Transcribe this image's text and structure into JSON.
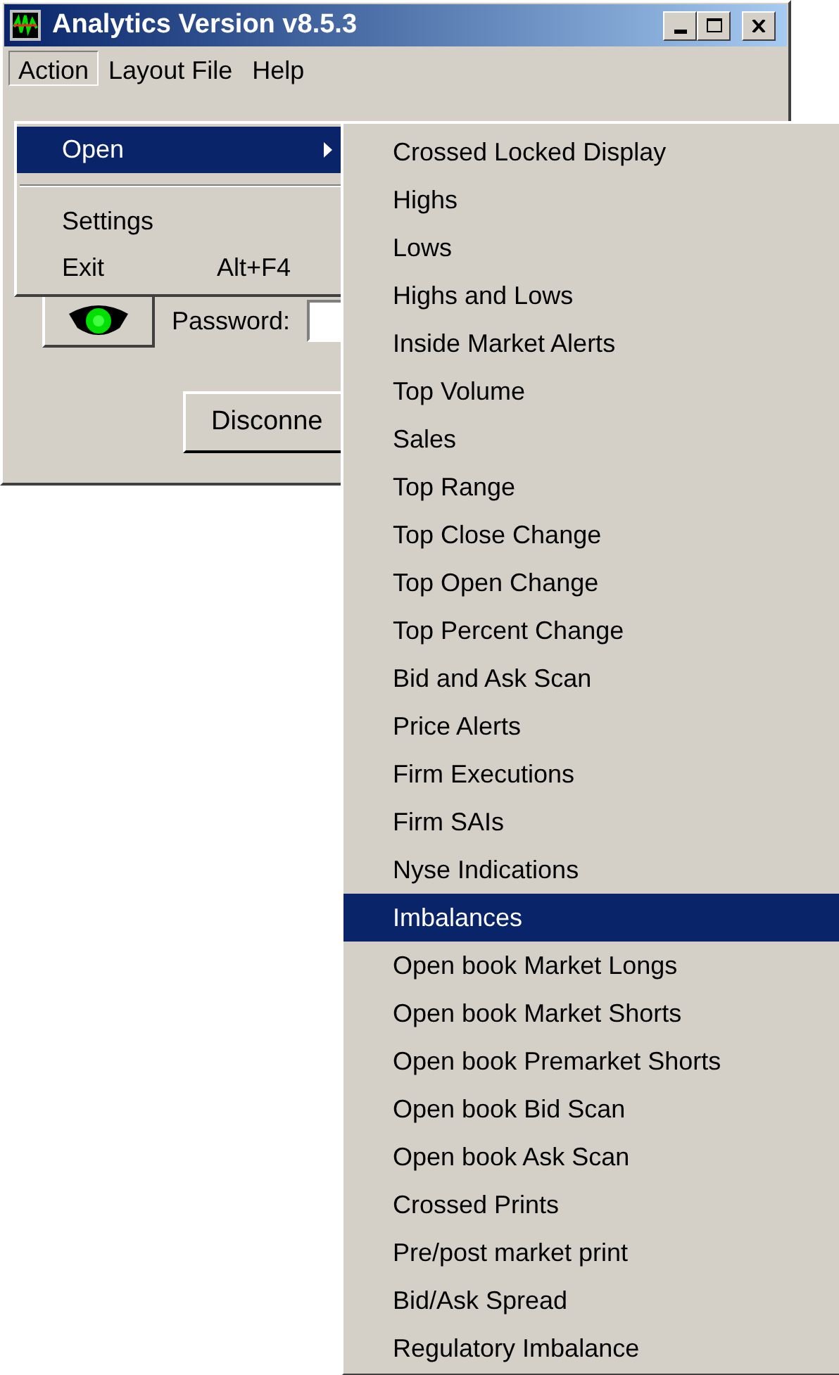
{
  "window": {
    "title": "Analytics Version v8.5.3"
  },
  "menu_bar": [
    {
      "label": "Action",
      "selected": true
    },
    {
      "label": "Layout File",
      "selected": false
    },
    {
      "label": "Help",
      "selected": false
    }
  ],
  "action_menu": [
    {
      "kind": "item",
      "label": "Open",
      "has_submenu": true,
      "selected": true
    },
    {
      "kind": "separator"
    },
    {
      "kind": "item",
      "label": "Settings",
      "selected": false
    },
    {
      "kind": "item",
      "label": "Exit",
      "shortcut": "Alt+F4",
      "selected": false
    }
  ],
  "body": {
    "password_label": "Password:",
    "disconnect_button": "Disconne"
  },
  "open_submenu": [
    {
      "label": "Crossed Locked Display",
      "selected": false
    },
    {
      "label": "Highs",
      "selected": false
    },
    {
      "label": "Lows",
      "selected": false
    },
    {
      "label": "Highs and Lows",
      "selected": false
    },
    {
      "label": "Inside Market Alerts",
      "selected": false
    },
    {
      "label": "Top Volume",
      "selected": false
    },
    {
      "label": "Sales",
      "selected": false
    },
    {
      "label": "Top Range",
      "selected": false
    },
    {
      "label": "Top Close Change",
      "selected": false
    },
    {
      "label": "Top Open Change",
      "selected": false
    },
    {
      "label": "Top Percent Change",
      "selected": false
    },
    {
      "label": "Bid and Ask Scan",
      "selected": false
    },
    {
      "label": "Price Alerts",
      "selected": false
    },
    {
      "label": "Firm Executions",
      "selected": false
    },
    {
      "label": "Firm SAIs",
      "selected": false
    },
    {
      "label": "Nyse Indications",
      "selected": false
    },
    {
      "label": "Imbalances",
      "selected": true
    },
    {
      "label": "Open book Market Longs",
      "selected": false
    },
    {
      "label": "Open book Market Shorts",
      "selected": false
    },
    {
      "label": "Open book Premarket Shorts",
      "selected": false
    },
    {
      "label": "Open book Bid Scan",
      "selected": false
    },
    {
      "label": "Open book Ask Scan",
      "selected": false
    },
    {
      "label": "Crossed Prints",
      "selected": false
    },
    {
      "label": "Pre/post market print",
      "selected": false
    },
    {
      "label": "Bid/Ask Spread",
      "selected": false
    },
    {
      "label": "Regulatory Imbalance",
      "selected": false
    }
  ]
}
